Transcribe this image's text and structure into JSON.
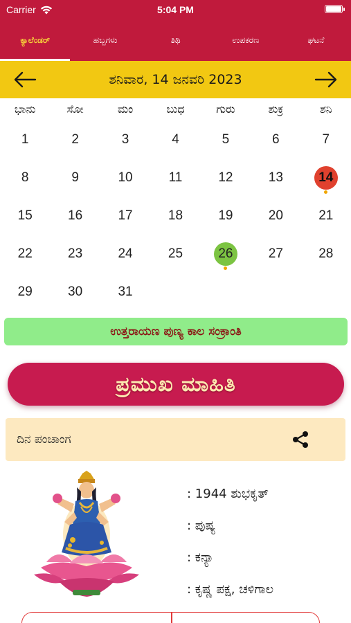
{
  "status": {
    "carrier": "Carrier",
    "time": "5:04 PM"
  },
  "tabs": [
    {
      "label": "ಕ್ಯಾಲೆಂಡರ್",
      "active": true
    },
    {
      "label": "ಹಬ್ಬಗಳು",
      "active": false
    },
    {
      "label": "ತಿಥಿ",
      "active": false
    },
    {
      "label": "ಉಪಕರಣ",
      "active": false
    },
    {
      "label": "ಘಟನೆ",
      "active": false
    }
  ],
  "date_bar": {
    "title": "ಶನಿವಾರ, 14 ಜನವರಿ 2023",
    "prev_icon": "arrow-left-icon",
    "next_icon": "arrow-right-icon"
  },
  "weekdays": [
    "ಭಾನು",
    "ಸೋ",
    "ಮಂ",
    "ಬುಧ",
    "ಗುರು",
    "ಶುಕ್ರ",
    "ಶನಿ"
  ],
  "calendar": {
    "days": [
      "1",
      "2",
      "3",
      "4",
      "5",
      "6",
      "7",
      "8",
      "9",
      "10",
      "11",
      "12",
      "13",
      "14",
      "15",
      "16",
      "17",
      "18",
      "19",
      "20",
      "21",
      "22",
      "23",
      "24",
      "25",
      "26",
      "27",
      "28",
      "29",
      "30",
      "31"
    ],
    "today": "14",
    "festival_day": "26",
    "today_color": "#e0412e",
    "festival_color": "#7cc442",
    "dot_color": "#f0a500"
  },
  "festival_banner": "ಉತ್ತರಾಯಣ ಪುಣ್ಯ ಕಾಲ ಸಂಕ್ರಾಂತಿ",
  "important_info_button": "ಪ್ರಮುಖ ಮಾಹಿತಿ",
  "panchanga": {
    "label": "ದಿನ ಪಂಚಾಂಗ",
    "share_icon": "share-icon"
  },
  "details": [
    ": 1944 ಶುಭಕೃತ್",
    ": ಪುಷ್ಯ",
    ": ಕನ್ಯಾ",
    ": ಕೃಷ್ಣ ಪಕ್ಷ, ಚಳಿಗಾಲ"
  ],
  "colors": {
    "primary": "#c01a3c",
    "date_bar": "#f2c812",
    "banner": "#90ec8a",
    "panchanga_bg": "#fde9c0"
  }
}
